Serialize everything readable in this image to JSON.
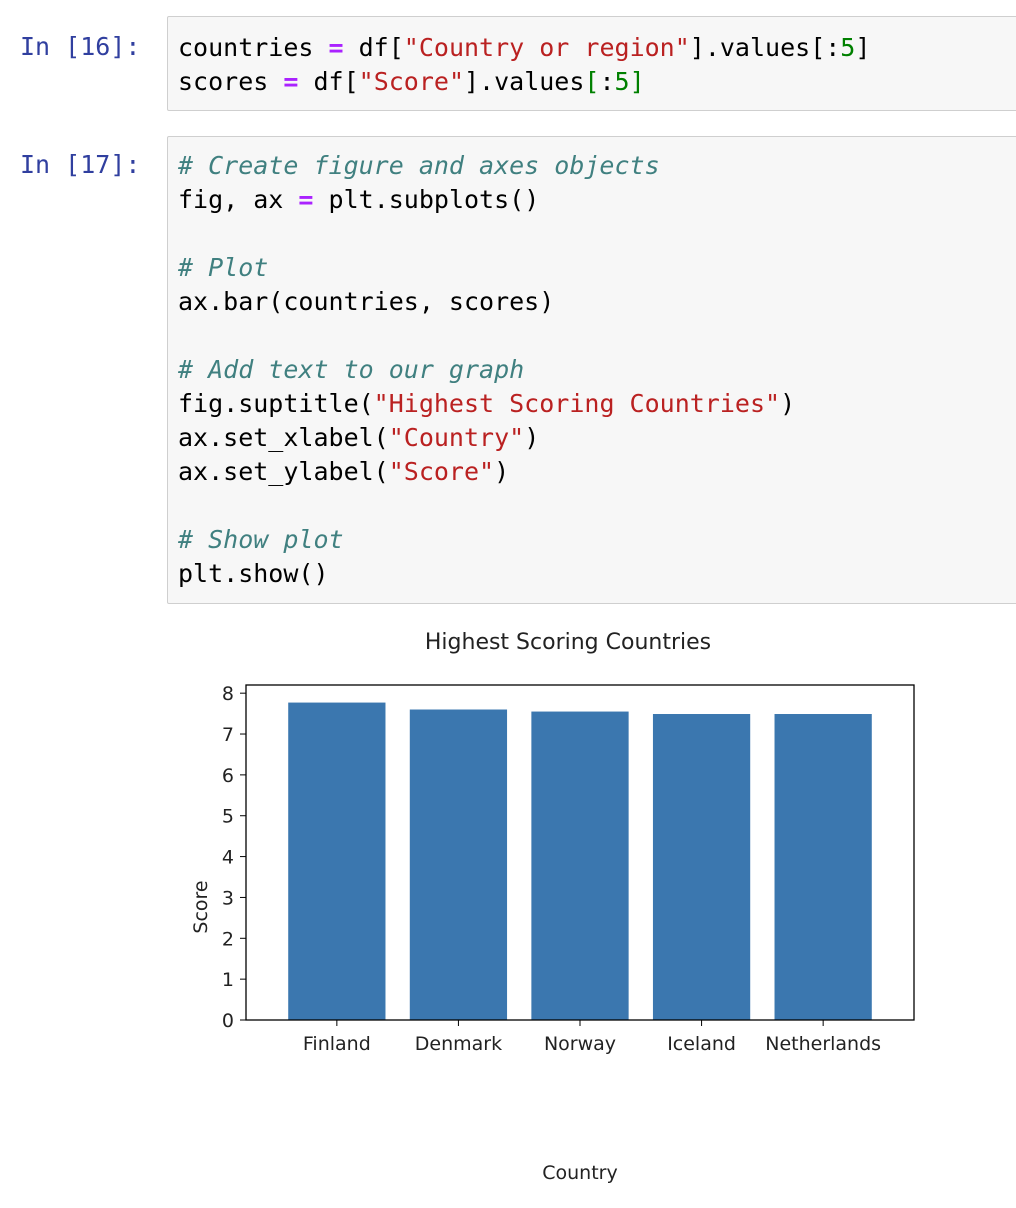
{
  "cells": [
    {
      "prompt": "In [16]:",
      "lines": [
        [
          {
            "t": "countries "
          },
          {
            "t": "=",
            "c": "kw-op"
          },
          {
            "t": " df["
          },
          {
            "t": "\"Country or region\"",
            "c": "str"
          },
          {
            "t": "].values[:"
          },
          {
            "t": "5",
            "c": "num"
          },
          {
            "t": "]"
          }
        ],
        [
          {
            "t": "scores "
          },
          {
            "t": "=",
            "c": "kw-op"
          },
          {
            "t": " df["
          },
          {
            "t": "\"Score\"",
            "c": "str"
          },
          {
            "t": "].values"
          },
          {
            "t": "[",
            "c": "bracket-hl"
          },
          {
            "t": ":"
          },
          {
            "t": "5",
            "c": "num"
          },
          {
            "t": "]",
            "c": "bracket-hl"
          }
        ]
      ]
    },
    {
      "prompt": "In [17]:",
      "lines": [
        [
          {
            "t": "# Create figure and axes objects",
            "c": "cm"
          }
        ],
        [
          {
            "t": "fig, ax "
          },
          {
            "t": "=",
            "c": "kw-op"
          },
          {
            "t": " plt.subplots()"
          }
        ],
        [
          {
            "t": ""
          }
        ],
        [
          {
            "t": "# Plot",
            "c": "cm"
          }
        ],
        [
          {
            "t": "ax.bar(countries, scores)"
          }
        ],
        [
          {
            "t": ""
          }
        ],
        [
          {
            "t": "# Add text to our graph",
            "c": "cm"
          }
        ],
        [
          {
            "t": "fig.suptitle("
          },
          {
            "t": "\"Highest Scoring Countries\"",
            "c": "str"
          },
          {
            "t": ")"
          }
        ],
        [
          {
            "t": "ax.set_xlabel("
          },
          {
            "t": "\"Country\"",
            "c": "str"
          },
          {
            "t": ")"
          }
        ],
        [
          {
            "t": "ax.set_ylabel("
          },
          {
            "t": "\"Score\"",
            "c": "str"
          },
          {
            "t": ")"
          }
        ],
        [
          {
            "t": ""
          }
        ],
        [
          {
            "t": "# Show plot",
            "c": "cm"
          }
        ],
        [
          {
            "t": "plt.show()"
          }
        ]
      ]
    }
  ],
  "chart_data": {
    "type": "bar",
    "title": "Highest Scoring Countries",
    "xlabel": "Country",
    "ylabel": "Score",
    "categories": [
      "Finland",
      "Denmark",
      "Norway",
      "Iceland",
      "Netherlands"
    ],
    "values": [
      7.77,
      7.6,
      7.55,
      7.49,
      7.49
    ],
    "ylim": [
      0,
      8.2
    ],
    "yticks": [
      0,
      1,
      2,
      3,
      4,
      5,
      6,
      7,
      8
    ],
    "bar_color": "#3b77af",
    "grid": false
  }
}
